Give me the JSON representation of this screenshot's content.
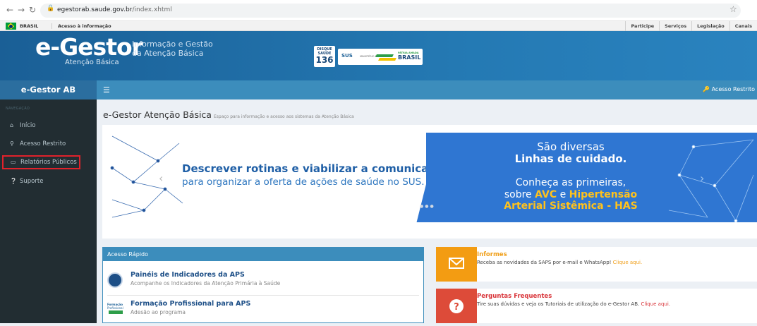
{
  "browser": {
    "url_domain": "egestorab.saude.gov.br",
    "url_path": "/index.xhtml",
    "back_icon": "arrow-left-icon",
    "forward_icon": "arrow-right-icon",
    "reload_icon": "reload-icon",
    "lock_icon": "lock-icon",
    "star_icon": "star-icon"
  },
  "govbar": {
    "brasil": "BRASIL",
    "acesso": "Acesso à informação",
    "links": [
      "Participe",
      "Serviços",
      "Legislação",
      "Canais"
    ]
  },
  "header": {
    "logo": "e-Gestor",
    "logo_sub": "Atenção Básica",
    "desc_line1": "Informação e Gestão",
    "desc_line2": "da Atenção Básica",
    "disque_label": "DISQUE SAÚDE",
    "disque_number": "136",
    "sus_label": "SUS",
    "ministerio": "MINISTÉRIO DA SAÚDE",
    "brasil_slogan": "PÁTRIA AMADA",
    "brasil_label": "BRASIL"
  },
  "appbar": {
    "brand": "e-Gestor AB",
    "menu_icon": "hamburger-icon",
    "restrito": "Acesso Restrito"
  },
  "sidebar": {
    "header": "NAVEGAÇÃO",
    "items": [
      {
        "label": "Início",
        "icon": "home-icon"
      },
      {
        "label": "Acesso Restrito",
        "icon": "key-icon"
      },
      {
        "label": "Relatórios Públicos",
        "icon": "laptop-icon"
      },
      {
        "label": "Suporte",
        "icon": "question-icon"
      }
    ]
  },
  "page": {
    "title": "e-Gestor Atenção Básica",
    "subtitle": "Espaço para informação e acesso aos sistemas da Atenção Básica"
  },
  "banner": {
    "left_line1": "Descrever rotinas e viabilizar a comunicação,",
    "left_line2": "para organizar a oferta de ações de saúde no SUS.",
    "right_line1": "São diversas",
    "right_line2": "Linhas de cuidado.",
    "right_line3": "Conheça as primeiras,",
    "right_line4_pre": "sobre ",
    "right_line4_avc": "AVC",
    "right_line4_mid": " e ",
    "right_line4_hip": "Hipertensão",
    "right_line5": "Arterial Sistêmica - HAS"
  },
  "acesso_rapido": {
    "title": "Acesso Rápido",
    "items": [
      {
        "title": "Painéis de Indicadores da APS",
        "subtitle": "Acompanhe os Indicadores da Atenção Primária à Saúde"
      },
      {
        "title": "Formação Profissional para APS",
        "subtitle": "Adesão ao programa"
      }
    ],
    "formacao_icon_l1": "Formação",
    "formacao_icon_l2": "Profissional"
  },
  "info": [
    {
      "title": "Informes",
      "text": "Receba as novidades da SAPS por e-mail e WhatsApp! ",
      "link": "Clique aqui.",
      "icon": "envelope-icon",
      "color": "#f39c12"
    },
    {
      "title": "Perguntas Frequentes",
      "text": "Tire suas dúvidas e veja os Tutoriais de utilização do e-Gestor AB. ",
      "link": "Clique aqui.",
      "icon": "question-icon",
      "color": "#dd4b39"
    }
  ],
  "colors": {
    "header_blue": "#2479b3",
    "appbar_blue": "#3c8dbc",
    "sidebar_dark": "#222d32",
    "highlight_red": "#e0222b",
    "banner_blue": "#2f76d2",
    "accent_yellow": "#ffc21c"
  }
}
